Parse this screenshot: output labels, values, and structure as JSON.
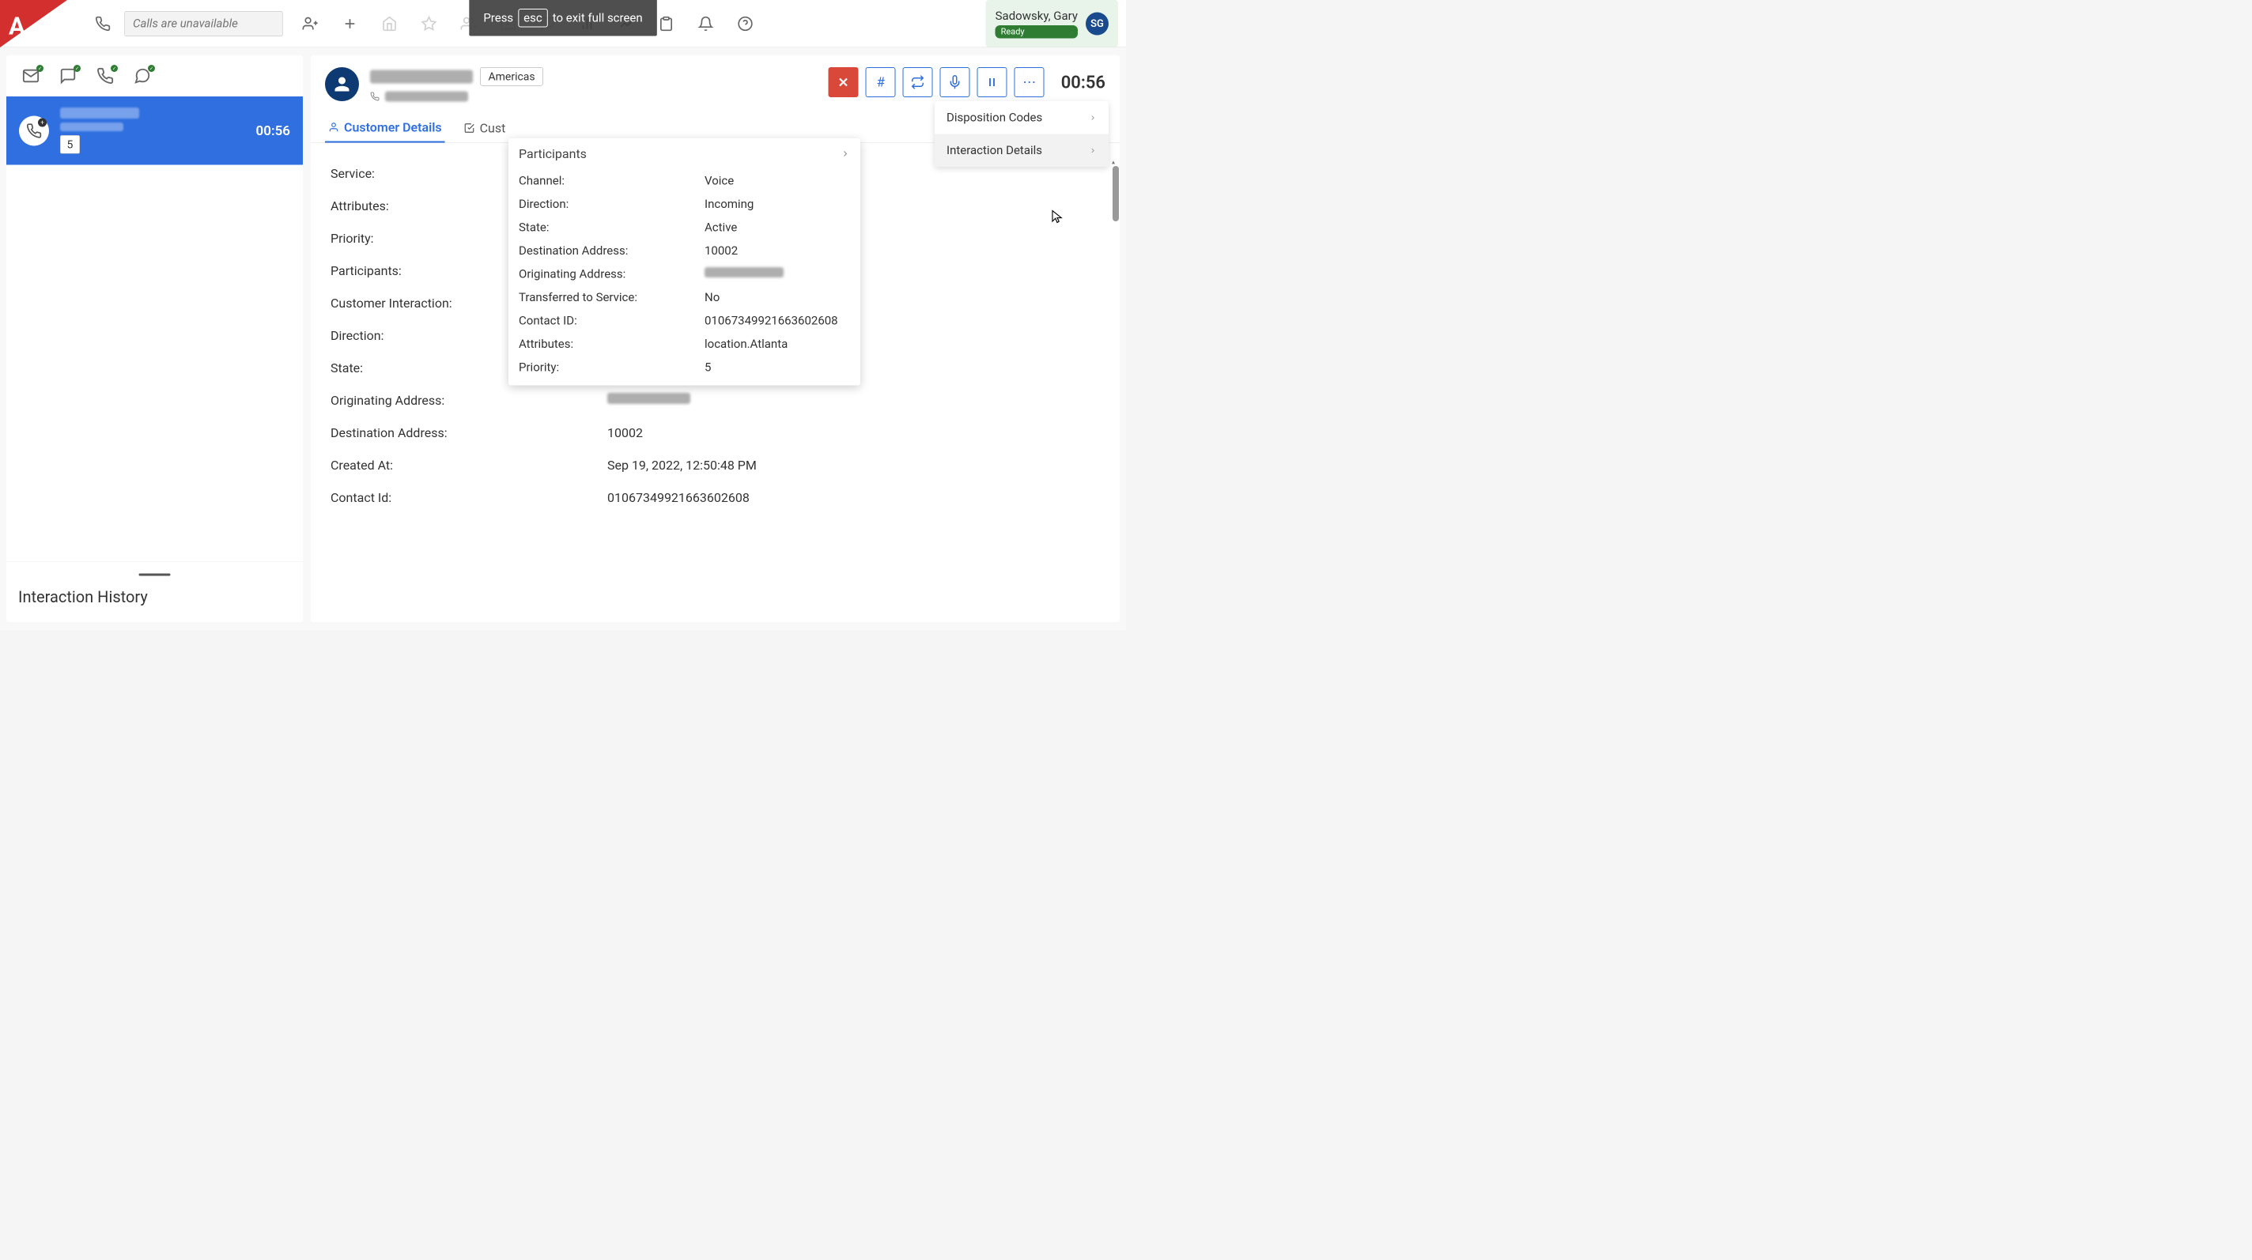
{
  "fullscreen_hint": {
    "prefix": "Press",
    "key": "esc",
    "suffix": "to exit full screen"
  },
  "topbar": {
    "call_placeholder": "Calls are unavailable"
  },
  "user": {
    "name": "Sadowsky, Gary",
    "status": "Ready",
    "initials": "SG"
  },
  "sidebar": {
    "active_call": {
      "time": "00:56",
      "badge": "5"
    },
    "history_title": "Interaction History"
  },
  "customer": {
    "region": "Americas",
    "timer": "00:56"
  },
  "tabs": {
    "customer_details": "Customer Details",
    "customer_journey": "Cust"
  },
  "details": {
    "service_label": "Service:",
    "attributes_label": "Attributes:",
    "priority_label": "Priority:",
    "participants_label": "Participants:",
    "customer_interaction_label": "Customer Interaction:",
    "direction_label": "Direction:",
    "direction_value": "Incoming",
    "state_label": "State:",
    "state_value": "Active",
    "originating_label": "Originating Address:",
    "destination_label": "Destination Address:",
    "destination_value": "10002",
    "created_label": "Created At:",
    "created_value": "Sep 19, 2022, 12:50:48 PM",
    "contact_label": "Contact Id:",
    "contact_value": "01067349921663602608"
  },
  "dropdown": {
    "item1": "Disposition Codes",
    "item2": "Interaction Details"
  },
  "popover": {
    "title": "Participants",
    "rows": [
      {
        "label": "Channel:",
        "value": "Voice"
      },
      {
        "label": "Direction:",
        "value": "Incoming"
      },
      {
        "label": "State:",
        "value": "Active"
      },
      {
        "label": "Destination Address:",
        "value": "10002"
      },
      {
        "label": "Originating Address:",
        "value": ""
      },
      {
        "label": "Transferred to Service:",
        "value": "No"
      },
      {
        "label": "Contact ID:",
        "value": "01067349921663602608"
      },
      {
        "label": "Attributes:",
        "value": "location.Atlanta"
      },
      {
        "label": "Priority:",
        "value": "5"
      }
    ]
  }
}
